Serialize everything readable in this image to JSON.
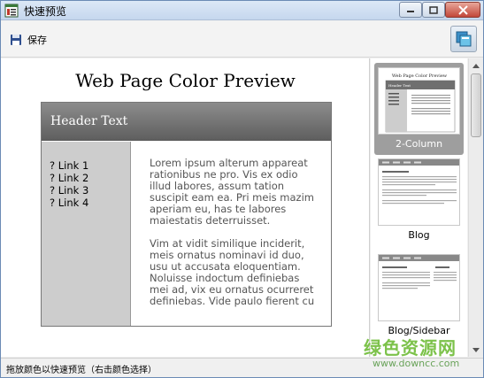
{
  "window": {
    "title": "快速预览"
  },
  "toolbar": {
    "save_label": "保存"
  },
  "preview": {
    "title": "Web Page Color Preview",
    "header_text": "Header Text",
    "links": [
      "? Link 1",
      "? Link 2",
      "? Link 3",
      "? Link 4"
    ],
    "paragraphs": [
      "Lorem ipsum alterum appareat\nrationibus ne pro. Vis ex odio\nillud labores, assum tation\nsuscipit eam ea. Pri meis mazim\naperiam eu, has te labores\nmaiestatis deterruisset.",
      "Vim at vidit similique inciderit,\nmeis ornatus nominavi id duo,\nusu ut accusata eloquentiam.\nNoluisse indoctum definiebas\nmei ad, vix eu ornatus ocurreret\ndefiniebas. Vide paulo fierent cu"
    ]
  },
  "templates": [
    {
      "label": "2-Column",
      "selected": true
    },
    {
      "label": "Blog",
      "selected": false
    },
    {
      "label": "Blog/Sidebar",
      "selected": false
    }
  ],
  "status": {
    "text": "拖放颜色以快速预览（右击颜色选择）"
  },
  "watermark": {
    "cn": "绿色资源网",
    "url": "www.downcc.com"
  },
  "colors": {
    "header": "#6f6f6f",
    "sidebar": "#cdcdcd",
    "selected_template": "#9e9e9e",
    "watermark": "#7cc24a"
  }
}
